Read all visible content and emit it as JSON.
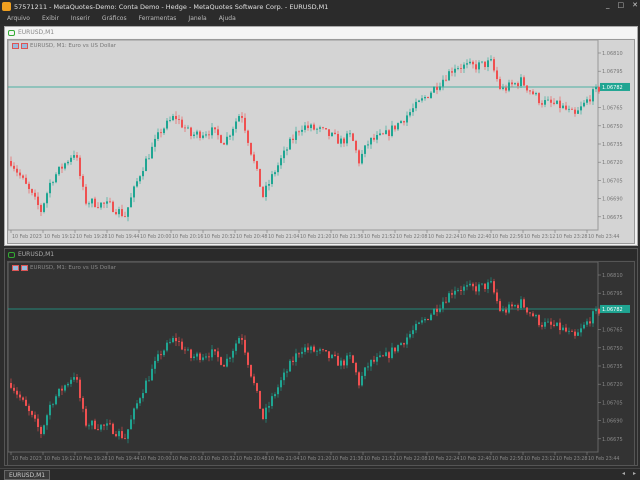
{
  "title": "57571211 - MetaQuotes-Demo: Conta Demo - Hedge - MetaQuotes Software Corp. - EURUSD,M1",
  "window_buttons": [
    "_",
    "□",
    "✕"
  ],
  "menu": [
    "Arquivo",
    "Exibir",
    "Inserir",
    "Gráficos",
    "Ferramentas",
    "Janela",
    "Ajuda"
  ],
  "windows": [
    {
      "title": "EURUSD,M1",
      "label": "EURUSD, M1:  Euro vs US Dollar",
      "theme": "light"
    },
    {
      "title": "EURUSD,M1",
      "label": "EURUSD, M1:  Euro vs US Dollar",
      "theme": "dark"
    }
  ],
  "tab": "EURUSD,M1",
  "colors": {
    "bull": "#1fa592",
    "bear": "#ef5050",
    "current_price_line": "#1fa592"
  },
  "chart_data": {
    "type": "candlestick",
    "symbol": "EURUSD",
    "timeframe": "M1",
    "current_price": "1.06782",
    "price_ticks": [
      "1.06810",
      "1.06795",
      "1.06765",
      "1.06750",
      "1.06735",
      "1.06720",
      "1.06705",
      "1.06690",
      "1.06675"
    ],
    "time_ticks": [
      "10 Feb 2023",
      "10 Feb 19:12",
      "10 Feb 19:28",
      "10 Feb 19:44",
      "10 Feb 20:00",
      "10 Feb 20:16",
      "10 Feb 20:32",
      "10 Feb 20:48",
      "10 Feb 21:04",
      "10 Feb 21:20",
      "10 Feb 21:36",
      "10 Feb 21:52",
      "10 Feb 22:08",
      "10 Feb 22:24",
      "10 Feb 22:40",
      "10 Feb 22:56",
      "10 Feb 23:12",
      "10 Feb 23:28",
      "10 Feb 23:44"
    ],
    "approx_close_path": [
      [
        "18:55",
        1.06721
      ],
      [
        "19:10",
        1.0668
      ],
      [
        "19:15",
        1.06705
      ],
      [
        "19:27",
        1.06729
      ],
      [
        "19:32",
        1.06688
      ],
      [
        "19:45",
        1.06684
      ],
      [
        "19:52",
        1.06676
      ],
      [
        "20:00",
        1.06713
      ],
      [
        "20:10",
        1.06746
      ],
      [
        "20:17",
        1.06758
      ],
      [
        "20:25",
        1.06742
      ],
      [
        "20:35",
        1.06746
      ],
      [
        "20:42",
        1.06737
      ],
      [
        "20:50",
        1.06762
      ],
      [
        "20:55",
        1.06729
      ],
      [
        "21:01",
        1.06692
      ],
      [
        "21:07",
        1.06713
      ],
      [
        "21:15",
        1.06737
      ],
      [
        "21:20",
        1.0675
      ],
      [
        "21:30",
        1.06746
      ],
      [
        "21:40",
        1.06737
      ],
      [
        "21:45",
        1.06742
      ],
      [
        "21:49",
        1.06721
      ],
      [
        "21:54",
        1.06737
      ],
      [
        "22:02",
        1.06742
      ],
      [
        "22:10",
        1.06754
      ],
      [
        "22:20",
        1.0677
      ],
      [
        "22:30",
        1.06787
      ],
      [
        "22:37",
        1.06799
      ],
      [
        "22:47",
        1.06799
      ],
      [
        "22:55",
        1.06802
      ],
      [
        "23:00",
        1.06779
      ],
      [
        "23:10",
        1.06787
      ],
      [
        "23:20",
        1.0677
      ],
      [
        "23:30",
        1.06766
      ],
      [
        "23:37",
        1.06758
      ],
      [
        "23:45",
        1.06775
      ],
      [
        "23:50",
        1.06782
      ]
    ]
  }
}
